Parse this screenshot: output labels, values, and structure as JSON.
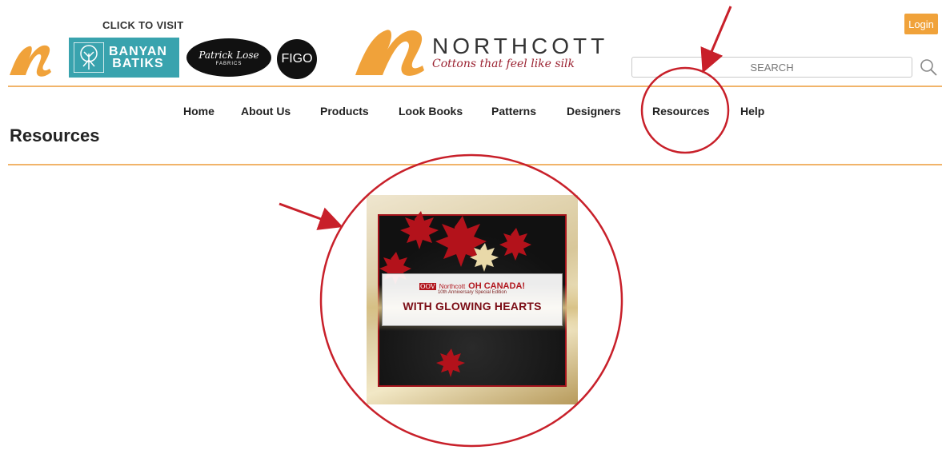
{
  "header": {
    "click_to_visit": "CLICK TO VISIT",
    "partner_logos": {
      "banyan_line1": "BANYAN",
      "banyan_line2": "BATIKS",
      "patrick_line1": "Patrick Lose",
      "patrick_line2": "FABRICS",
      "figo": "FIGO"
    },
    "brand": {
      "name": "NORTHCOTT",
      "tagline": "Cottons that feel like silk"
    },
    "login_label": "Login",
    "search": {
      "placeholder": "SEARCH"
    }
  },
  "nav": {
    "items": [
      {
        "label": "Home"
      },
      {
        "label": "About Us"
      },
      {
        "label": "Products"
      },
      {
        "label": "Look Books"
      },
      {
        "label": "Patterns"
      },
      {
        "label": "Designers"
      },
      {
        "label": "Resources"
      },
      {
        "label": "Help"
      }
    ]
  },
  "page": {
    "title": "Resources"
  },
  "banner": {
    "logo_mark": "OOV",
    "series": "Northcott",
    "collection": "OH CANADA!",
    "edition": "10th Anniversary Special Edition",
    "headline": "WITH GLOWING HEARTS"
  },
  "colors": {
    "accent_orange": "#f0a23a",
    "rule": "#f1b46a",
    "annotation_red": "#c8202a",
    "teal": "#39a3ae",
    "maroon": "#7b0d16"
  }
}
